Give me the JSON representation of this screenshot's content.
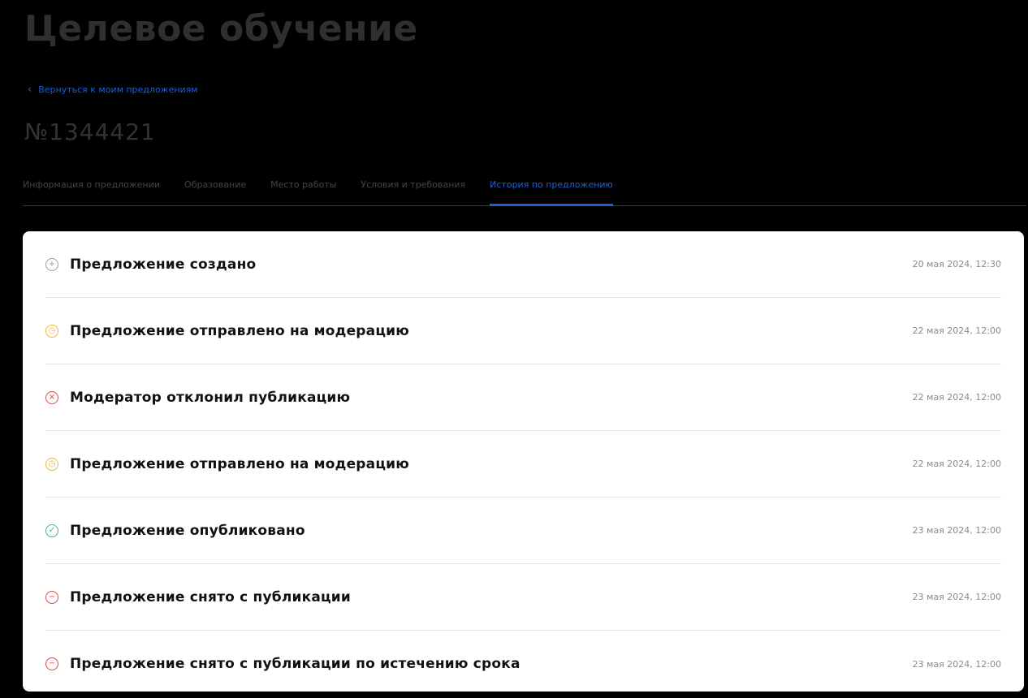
{
  "page": {
    "title": "Целевое обучение",
    "back_link": "Вернуться к моим предложениям",
    "offer_number": "№1344421"
  },
  "tabs": [
    {
      "label": "Информация о предложении",
      "active": false
    },
    {
      "label": "Образование",
      "active": false
    },
    {
      "label": "Место работы",
      "active": false
    },
    {
      "label": "Условия и требования",
      "active": false
    },
    {
      "label": "История по предложению",
      "active": true
    }
  ],
  "history": [
    {
      "label": "Предложение создано",
      "date": "20 мая 2024, 12:30",
      "icon": "plus-circle-icon",
      "color": "#9a9a9a"
    },
    {
      "label": "Предложение отправлено на модерацию",
      "date": "22 мая 2024, 12:00",
      "icon": "clock-icon",
      "color": "#f0b23a"
    },
    {
      "label": "Модератор отклонил публикацию",
      "date": "22 мая 2024, 12:00",
      "icon": "x-circle-icon",
      "color": "#e04646"
    },
    {
      "label": "Предложение отправлено на модерацию",
      "date": "22 мая 2024, 12:00",
      "icon": "clock-icon",
      "color": "#f0b23a"
    },
    {
      "label": "Предложение опубликовано",
      "date": "23 мая 2024, 12:00",
      "icon": "check-circle-icon",
      "color": "#3fb97a"
    },
    {
      "label": "Предложение снято с публикации",
      "date": "23 мая 2024, 12:00",
      "icon": "minus-circle-icon",
      "color": "#e04646"
    },
    {
      "label": "Предложение снято с публикации по истечению срока",
      "date": "23 мая 2024, 12:00",
      "icon": "minus-circle-icon",
      "color": "#e04646"
    }
  ]
}
